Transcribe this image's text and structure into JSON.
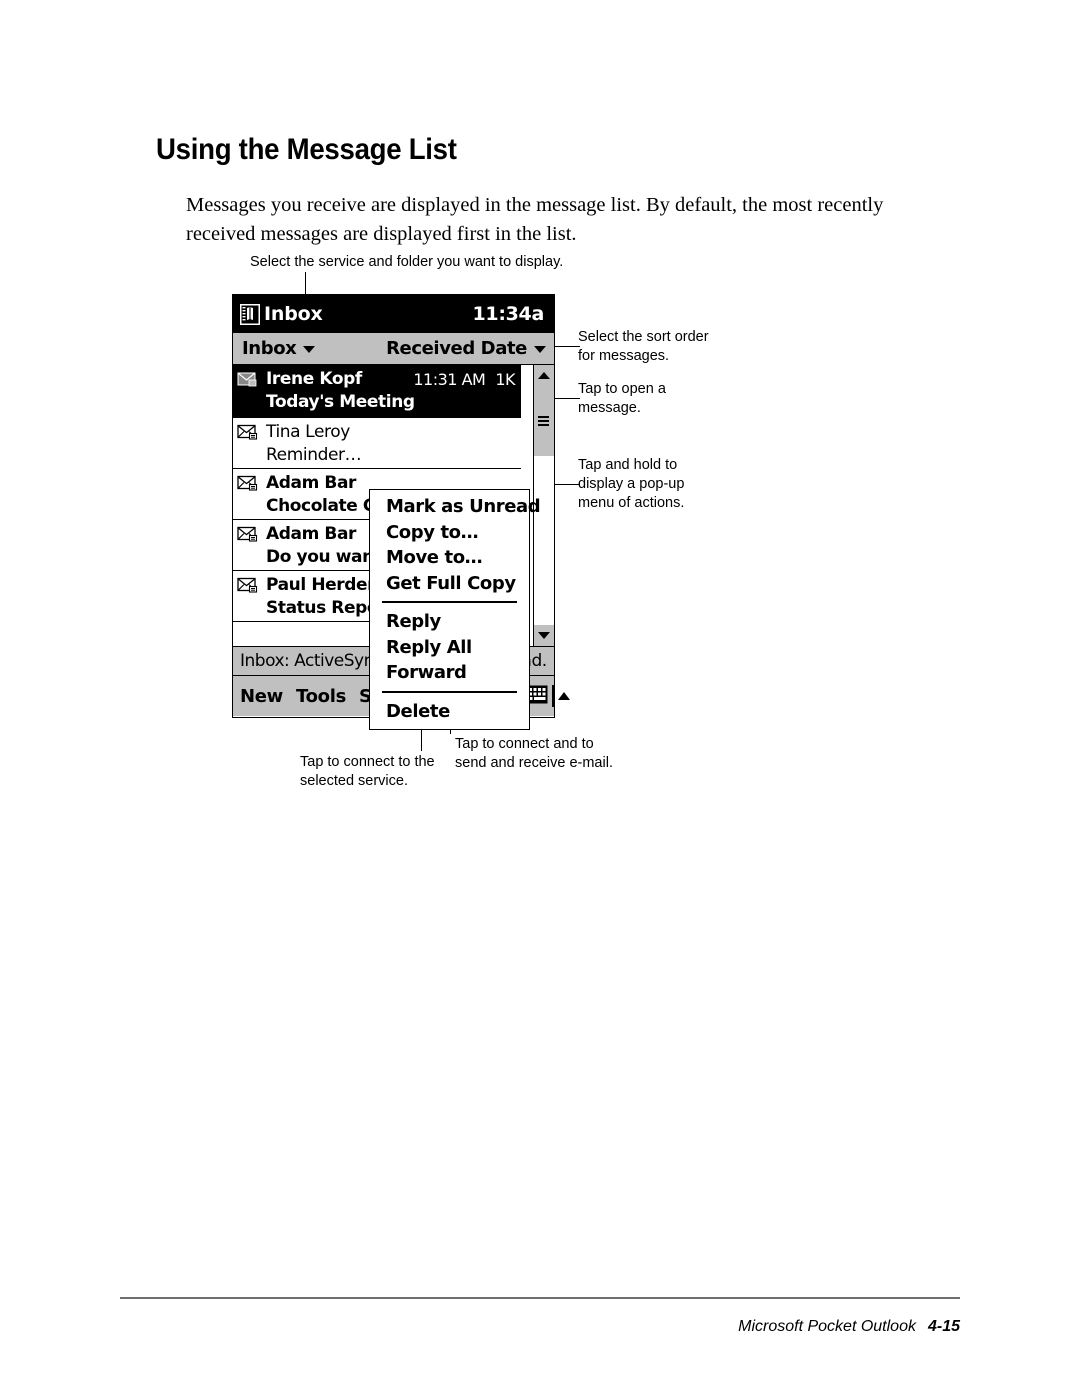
{
  "page": {
    "title": "Using the Message List",
    "intro": "Messages you receive are displayed in the message list. By default, the most recently received messages are displayed first in the list.",
    "footer_text": "Microsoft Pocket Outlook",
    "footer_page": "4-15"
  },
  "callouts": {
    "top": "Select the service and folder you want to display.",
    "sort_order": "Select the sort order\nfor messages.",
    "open_message": "Tap to open a\nmessage.",
    "popup_menu": "Tap and hold to\ndisplay a pop-up\nmenu of actions.",
    "connect_service": "Tap to connect to the\nselected service.",
    "send_receive": "Tap to connect and to\nsend and receive e-mail."
  },
  "device": {
    "titlebar": {
      "app_icon": "inbox-app-icon",
      "title": "Inbox",
      "clock": "11:34a"
    },
    "filterbar": {
      "folder": "Inbox",
      "sort": "Received Date"
    },
    "messages": [
      {
        "icon": "meeting-request-icon",
        "sender": "Irene Kopf",
        "time": "11:31 AM",
        "size": "1K",
        "subject": "Today's Meeting",
        "selected": true,
        "read": false
      },
      {
        "icon": "envelope-icon",
        "sender": "Tina Leroy",
        "time": "",
        "size": "",
        "subject": "Reminder…",
        "selected": false,
        "read": true
      },
      {
        "icon": "envelope-icon",
        "sender": "Adam Bar",
        "time": "",
        "size": "",
        "subject": "Chocolate C",
        "selected": false,
        "read": false
      },
      {
        "icon": "envelope-icon",
        "sender": "Adam Bar",
        "time": "",
        "size": "",
        "subject": "Do you wan",
        "selected": false,
        "read": false
      },
      {
        "icon": "envelope-icon",
        "sender": "Paul Herder",
        "time": "",
        "size": "",
        "subject": "Status Repo",
        "selected": false,
        "read": false
      }
    ],
    "popup_menu": [
      {
        "label": "Mark as Unread",
        "type": "item"
      },
      {
        "label": "Copy to…",
        "type": "item"
      },
      {
        "label": "Move to…",
        "type": "item"
      },
      {
        "label": "Get Full Copy",
        "type": "item"
      },
      {
        "label": "",
        "type": "separator"
      },
      {
        "label": "Reply",
        "type": "item"
      },
      {
        "label": "Reply All",
        "type": "item"
      },
      {
        "label": "Forward",
        "type": "item"
      },
      {
        "label": "",
        "type": "separator"
      },
      {
        "label": "Delete",
        "type": "item"
      }
    ],
    "statusbar": "Inbox: ActiveSync  23 Items, 9 Unread.",
    "commandbar": {
      "menus": [
        "New",
        "Tools",
        "Services"
      ],
      "icons": [
        "connect-icon",
        "send-receive-icon"
      ],
      "sip_icon": "keyboard-icon",
      "sip_arrow": "chevron-up-icon"
    }
  },
  "colors": {
    "chrome": "#c0c0c0",
    "titlebar": "#000000",
    "selection": "#000000",
    "rule": "#6e6e6e"
  }
}
